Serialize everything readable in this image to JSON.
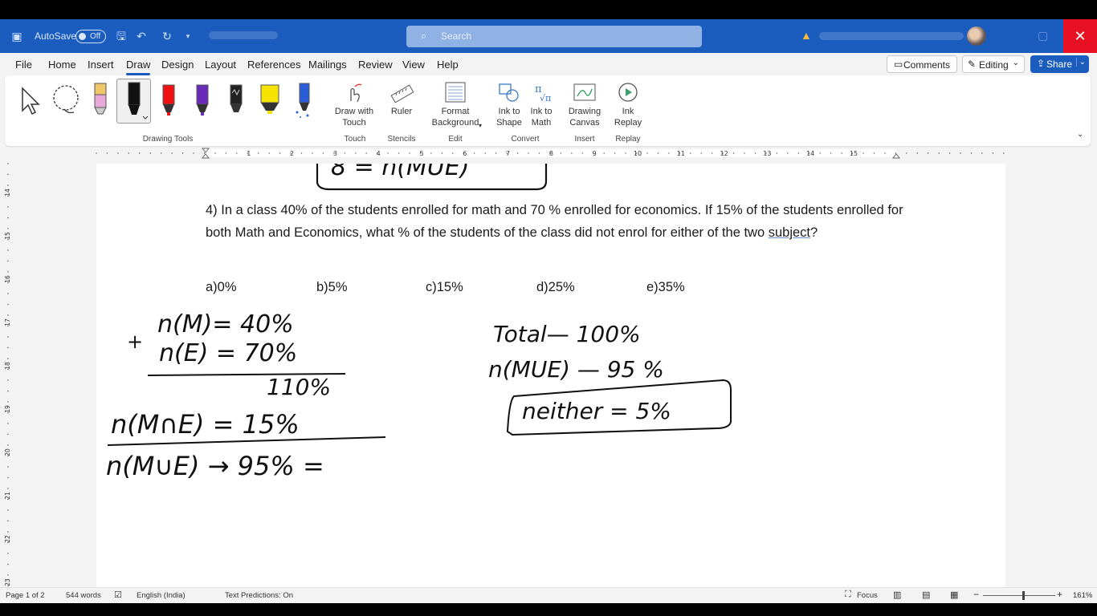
{
  "titlebar": {
    "autosave_label": "AutoSave",
    "autosave_state": "Off",
    "search_placeholder": "Search",
    "close_glyph": "✕"
  },
  "menu": {
    "items": [
      "File",
      "Home",
      "Insert",
      "Draw",
      "Design",
      "Layout",
      "References",
      "Mailings",
      "Review",
      "View",
      "Help"
    ],
    "active": "Draw",
    "comments_label": "Comments",
    "editing_label": "Editing",
    "share_label": "Share"
  },
  "ribbon": {
    "buttons": {
      "draw_touch": "Draw with Touch",
      "ruler": "Ruler",
      "format_bg": "Format Background",
      "ink_shape": "Ink to Shape",
      "ink_math": "Ink to Math",
      "drawing_canvas": "Drawing Canvas",
      "ink_replay": "Ink Replay"
    },
    "groups": {
      "drawing_tools": "Drawing Tools",
      "touch": "Touch",
      "stencils": "Stencils",
      "edit": "Edit",
      "convert": "Convert",
      "insert": "Insert",
      "replay": "Replay"
    }
  },
  "ruler": {
    "numbers": [
      "1",
      "2",
      "3",
      "4",
      "5",
      "6",
      "7",
      "8",
      "9",
      "10",
      "11",
      "12",
      "13",
      "14",
      "15"
    ],
    "vertical_numbers": [
      "14",
      "15",
      "16",
      "17",
      "18",
      "19",
      "20",
      "21",
      "22",
      "23"
    ]
  },
  "document": {
    "question_main": "4) In a class 40% of the students enrolled for math and 70 % enrolled for economics. If 15% of the students enrolled for both Math and Economics, what % of the students of the class did not enrol for either of the two ",
    "question_underlined": "subject",
    "question_end": "?",
    "options": [
      "a)0%",
      "b)5%",
      "c)15%",
      "d)25%",
      "e)35%"
    ],
    "ink_notes": {
      "top_fragment": "8 = n(MUE)",
      "plus_sign": "+",
      "n_m": "n(M)= 40%",
      "n_e": "n(E) = 70%",
      "sum": "110%",
      "n_intersection": "n(M∩E) = 15%",
      "n_union": "n(M∪E) → 95% =",
      "total": "Total— 100%",
      "n_union_2": "n(MUE) — 95 %",
      "neither": "neither = 5%"
    }
  },
  "statusbar": {
    "page": "Page 1 of 2",
    "words": "544 words",
    "language": "English (India)",
    "predictions": "Text Predictions: On",
    "focus": "Focus",
    "zoom": "161%"
  },
  "colors": {
    "brand_blue": "#1b5cbf",
    "close_red": "#e81123",
    "ink": "#111111"
  }
}
